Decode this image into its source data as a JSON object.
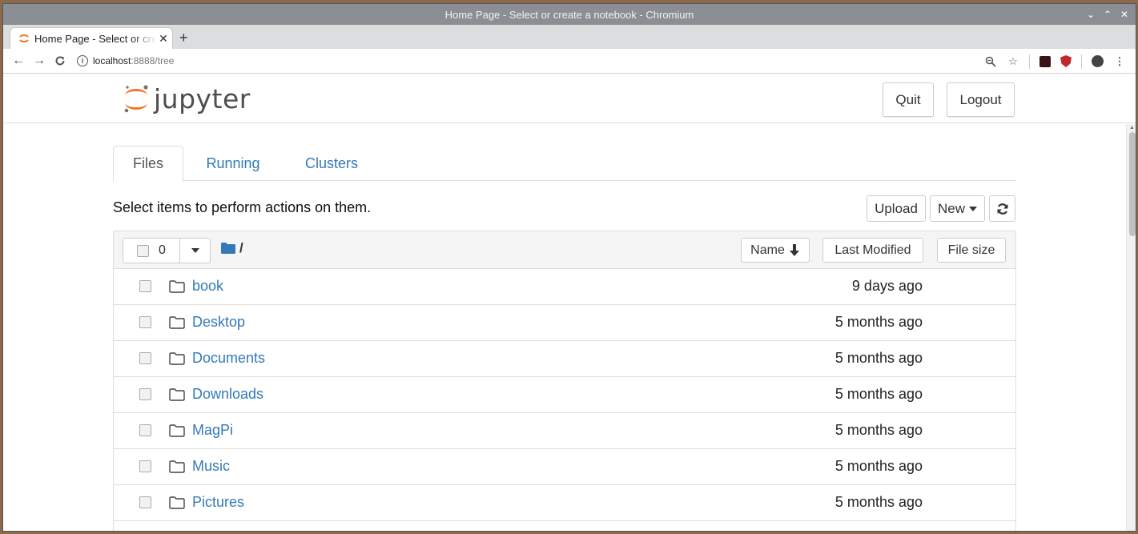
{
  "browser": {
    "window_title": "Home Page - Select or create a notebook - Chromium",
    "tab_title": "Home Page - Select or create a notebook",
    "url_host": "localhost",
    "url_path": ":8888/tree"
  },
  "header": {
    "logo_text": "jupyter",
    "quit_label": "Quit",
    "logout_label": "Logout"
  },
  "tabs": [
    {
      "label": "Files"
    },
    {
      "label": "Running"
    },
    {
      "label": "Clusters"
    }
  ],
  "toolbar": {
    "message": "Select items to perform actions on them.",
    "upload_label": "Upload",
    "new_label": "New"
  },
  "list_header": {
    "selected_count": "0",
    "path": "/",
    "name_label": "Name",
    "last_modified_label": "Last Modified",
    "file_size_label": "File size"
  },
  "files": [
    {
      "name": "book",
      "modified": "9 days ago"
    },
    {
      "name": "Desktop",
      "modified": "5 months ago"
    },
    {
      "name": "Documents",
      "modified": "5 months ago"
    },
    {
      "name": "Downloads",
      "modified": "5 months ago"
    },
    {
      "name": "MagPi",
      "modified": "5 months ago"
    },
    {
      "name": "Music",
      "modified": "5 months ago"
    },
    {
      "name": "Pictures",
      "modified": "5 months ago"
    }
  ],
  "colors": {
    "link": "#337ab7",
    "jupyter_orange": "#f37726",
    "folder_blue": "#337ab7"
  }
}
